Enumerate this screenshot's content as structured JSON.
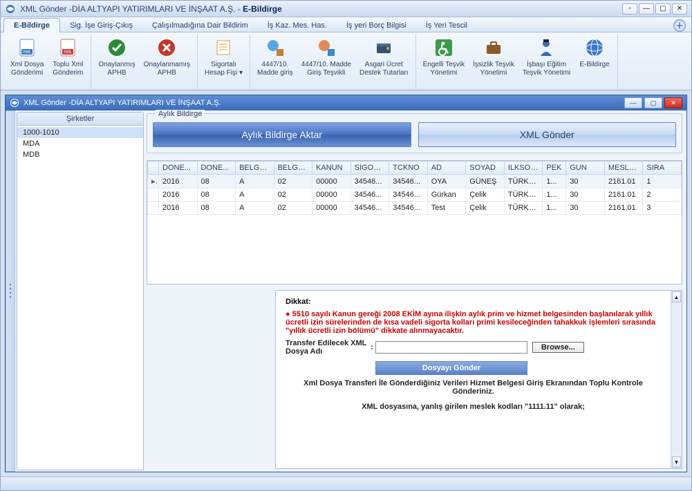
{
  "window": {
    "title_prefix": "XML Gönder -DİA ALTYAPI YATIRIMLARI VE İNŞAAT A.Ş. - ",
    "title_bold": "E-Bildirge"
  },
  "tabs": {
    "items": [
      "E-Bildirge",
      "Sig. İşe Giriş-Çıkış",
      "Çalışılmadığına Dair Bildirim",
      "İş Kaz. Mes. Has.",
      "İş yeri Borç Bilgisi",
      "İş Yeri Tescil"
    ],
    "active": 0
  },
  "ribbon": [
    {
      "label": "Xml Dosya\nGönderimi",
      "icon": "xml-doc"
    },
    {
      "label": "Toplu Xml\nGönderim",
      "icon": "xml-doc-red"
    },
    {
      "label": "Onaylanmış\nAPHB",
      "icon": "check-circle"
    },
    {
      "label": "Onaylanmamış\nAPHB",
      "icon": "x-circle"
    },
    {
      "label": "Sigortalı\nHesap Fişi ▾",
      "icon": "receipt"
    },
    {
      "label": "4447/10.\nMadde giriş",
      "icon": "globe-bag"
    },
    {
      "label": "4447/10. Madde\nGiriş Teşvikli",
      "icon": "globe-bag2"
    },
    {
      "label": "Asgari Ücret\nDestek Tutarları",
      "icon": "wallet"
    },
    {
      "label": "Engelli Teşvik\nYönetimi",
      "icon": "wheelchair"
    },
    {
      "label": "İşsizlik Teşvik\nYönetimi",
      "icon": "briefcase"
    },
    {
      "label": "İşbaşı Eğitim\nTeşvik Yönetimi",
      "icon": "person"
    },
    {
      "label": "E-Bildirge",
      "icon": "globe"
    }
  ],
  "inner": {
    "title": "XML Gönder -DİA ALTYAPI YATIRIMLARI VE İNŞAAT A.Ş."
  },
  "sidebar": {
    "header": "Şirketler",
    "items": [
      "1000-1010",
      "MDA",
      "MDB"
    ],
    "selected": 0
  },
  "bildirge": {
    "box_label": "Aylık Bildirge",
    "btn_aktar": "Aylık Bildirge Aktar",
    "btn_gonder": "XML Gönder"
  },
  "grid": {
    "cols": [
      "DONE...",
      "DONE...",
      "BELGE...",
      "BELGE...",
      "KANUN",
      "SIGOR...",
      "TCKNO",
      "AD",
      "SOYAD",
      "ILKSOY...",
      "PEK",
      "GUN",
      "MESLEKK...",
      "SIRA"
    ],
    "rows": [
      [
        "2016",
        "08",
        "A",
        "02",
        "00000",
        "34546...",
        "34546...",
        "OYA",
        "GÜNEŞ",
        "TÜRKMEN",
        "1...",
        "30",
        "2161.01",
        "1"
      ],
      [
        "2016",
        "08",
        "A",
        "02",
        "00000",
        "34546...",
        "34546...",
        "Gürkan",
        "Çelik",
        "TÜRKMEN",
        "1...",
        "30",
        "2161.01",
        "2"
      ],
      [
        "2016",
        "08",
        "A",
        "02",
        "00000",
        "34546...",
        "34546...",
        "Test",
        "Çelik",
        "TÜRKMEN",
        "1...",
        "30",
        "2161.01",
        "3"
      ]
    ],
    "selected": 0
  },
  "notice": {
    "head": "Dikkat:",
    "red": "●  5510 sayılı Kanun gereği 2008 EKİM ayına ilişkin aylık prim ve hizmet belgesinden başlanılarak yıllık ücretli izin sürelerinden de kısa vadeli sigorta kolları primi kesileceğinden tahakkuk işlemleri sırasında \"yıllık ücretli izin bölümü\" dikkate alınmayacaktır.",
    "transfer_label": "Transfer Edilecek XML Dosya Adı",
    "colon": ":",
    "path_value": "",
    "browse": "Browse...",
    "send": "Dosyayı Gönder",
    "info1": "Xml Dosya Transferi İle Gönderdiğiniz Verileri Hizmet Belgesi Giriş Ekranından Toplu Kontrole Gönderiniz.",
    "info2": "XML dosyasına, yanlış girilen meslek kodları \"1111.11\" olarak;"
  }
}
